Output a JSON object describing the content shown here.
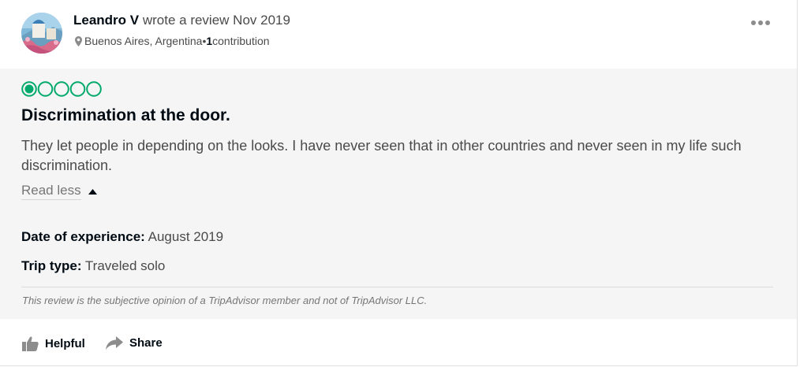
{
  "review": {
    "author_name": "Leandro V",
    "action_text": " wrote a review Nov 2019",
    "location": "Buenos Aires, Argentina",
    "separator": " • ",
    "contribution_count": "1",
    "contribution_label": " contribution",
    "rating": 1,
    "rating_max": 5,
    "title": "Discrimination at the door.",
    "text": "They let people in depending on the looks. I have never seen that in other countries and never seen in my life such discrimination.",
    "read_less_label": "Read less",
    "date_of_experience_label": "Date of experience:",
    "date_of_experience_value": " August 2019",
    "trip_type_label": "Trip type:",
    "trip_type_value": " Traveled solo",
    "disclaimer": "This review is the subjective opinion of a TripAdvisor member and not of TripAdvisor LLC."
  },
  "actions": {
    "helpful_label": "Helpful",
    "share_label": "Share"
  },
  "colors": {
    "rating_green": "#00aa6c",
    "body_background": "#f5f5f5"
  }
}
